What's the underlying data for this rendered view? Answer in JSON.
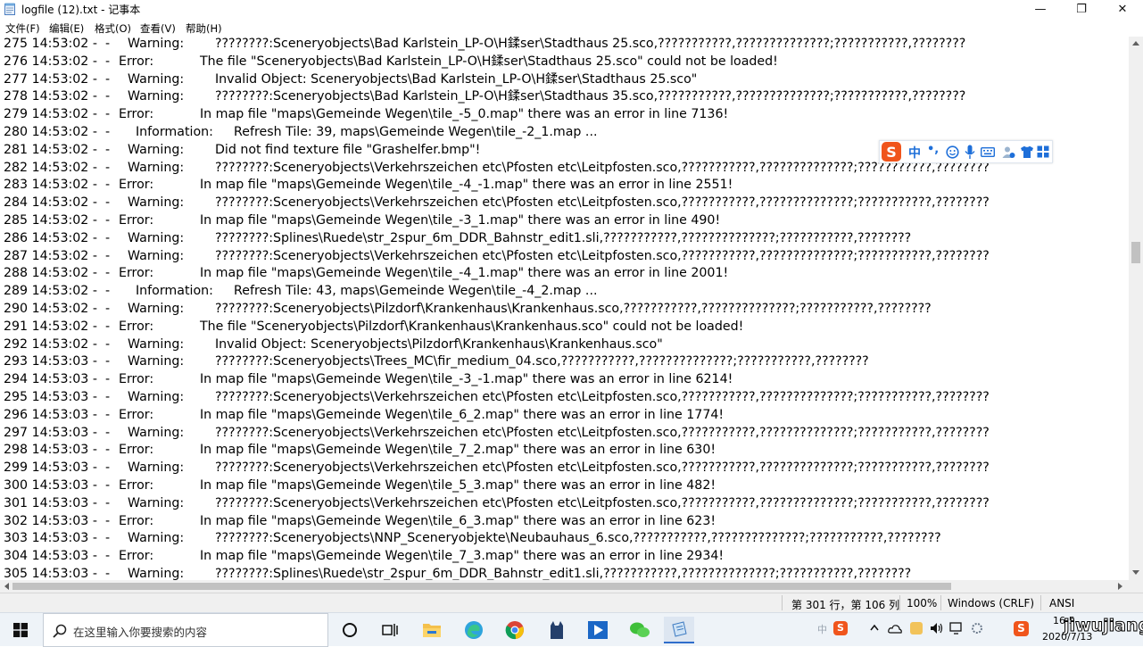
{
  "window": {
    "title": "logfile (12).txt - 记事本",
    "controls": {
      "minimize": "—",
      "maximize": "❐",
      "close": "✕"
    }
  },
  "menu": [
    "文件(F)",
    "编辑(E)",
    "格式(O)",
    "查看(V)",
    "帮助(H)"
  ],
  "log_lines": [
    {
      "prefix": "275 14:53:02 -  -",
      "level": "Warning:",
      "msg": "????????:Sceneryobjects\\Bad Karlstein_LP-O\\H鍒ser\\Stadthaus 25.sco,???????????,??????????????;???????????,????????"
    },
    {
      "prefix": "276 14:53:02 -  -",
      "level": "Error:",
      "msg": "The file \"Sceneryobjects\\Bad Karlstein_LP-O\\H鍒ser\\Stadthaus 25.sco\" could not be loaded!"
    },
    {
      "prefix": "277 14:53:02 -  -",
      "level": "Warning:",
      "msg": "Invalid Object: Sceneryobjects\\Bad Karlstein_LP-O\\H鍒ser\\Stadthaus 25.sco\""
    },
    {
      "prefix": "278 14:53:02 -  -",
      "level": "Warning:",
      "msg": "????????:Sceneryobjects\\Bad Karlstein_LP-O\\H鍒ser\\Stadthaus 35.sco,???????????,??????????????;???????????,????????"
    },
    {
      "prefix": "279 14:53:02 -  -",
      "level": "Error:",
      "msg": "In map file \"maps\\Gemeinde Wegen\\tile_-5_0.map\" there was an error in line 7136!"
    },
    {
      "prefix": "280 14:53:02 -  -",
      "level": "Information:",
      "msg": "Refresh Tile: 39, maps\\Gemeinde Wegen\\tile_-2_1.map ..."
    },
    {
      "prefix": "281 14:53:02 -  -",
      "level": "Warning:",
      "msg": "Did not find texture file \"Grashelfer.bmp\"!"
    },
    {
      "prefix": "282 14:53:02 -  -",
      "level": "Warning:",
      "msg": "????????:Sceneryobjects\\Verkehrszeichen etc\\Pfosten etc\\Leitpfosten.sco,???????????,??????????????;???????????,????????"
    },
    {
      "prefix": "283 14:53:02 -  -",
      "level": "Error:",
      "msg": "In map file \"maps\\Gemeinde Wegen\\tile_-4_-1.map\" there was an error in line 2551!"
    },
    {
      "prefix": "284 14:53:02 -  -",
      "level": "Warning:",
      "msg": "????????:Sceneryobjects\\Verkehrszeichen etc\\Pfosten etc\\Leitpfosten.sco,???????????,??????????????;???????????,????????"
    },
    {
      "prefix": "285 14:53:02 -  -",
      "level": "Error:",
      "msg": "In map file \"maps\\Gemeinde Wegen\\tile_-3_1.map\" there was an error in line 490!"
    },
    {
      "prefix": "286 14:53:02 -  -",
      "level": "Warning:",
      "msg": "????????:Splines\\Ruede\\str_2spur_6m_DDR_Bahnstr_edit1.sli,???????????,??????????????;???????????,????????"
    },
    {
      "prefix": "287 14:53:02 -  -",
      "level": "Warning:",
      "msg": "????????:Sceneryobjects\\Verkehrszeichen etc\\Pfosten etc\\Leitpfosten.sco,???????????,??????????????;???????????,????????"
    },
    {
      "prefix": "288 14:53:02 -  -",
      "level": "Error:",
      "msg": "In map file \"maps\\Gemeinde Wegen\\tile_-4_1.map\" there was an error in line 2001!"
    },
    {
      "prefix": "289 14:53:02 -  -",
      "level": "Information:",
      "msg": "Refresh Tile: 43, maps\\Gemeinde Wegen\\tile_-4_2.map ..."
    },
    {
      "prefix": "290 14:53:02 -  -",
      "level": "Warning:",
      "msg": "????????:Sceneryobjects\\Pilzdorf\\Krankenhaus\\Krankenhaus.sco,???????????,??????????????;???????????,????????"
    },
    {
      "prefix": "291 14:53:02 -  -",
      "level": "Error:",
      "msg": "The file \"Sceneryobjects\\Pilzdorf\\Krankenhaus\\Krankenhaus.sco\" could not be loaded!"
    },
    {
      "prefix": "292 14:53:02 -  -",
      "level": "Warning:",
      "msg": "Invalid Object: Sceneryobjects\\Pilzdorf\\Krankenhaus\\Krankenhaus.sco\""
    },
    {
      "prefix": "293 14:53:03 -  -",
      "level": "Warning:",
      "msg": "????????:Sceneryobjects\\Trees_MC\\fir_medium_04.sco,???????????,??????????????;???????????,????????"
    },
    {
      "prefix": "294 14:53:03 -  -",
      "level": "Error:",
      "msg": "In map file \"maps\\Gemeinde Wegen\\tile_-3_-1.map\" there was an error in line 6214!"
    },
    {
      "prefix": "295 14:53:03 -  -",
      "level": "Warning:",
      "msg": "????????:Sceneryobjects\\Verkehrszeichen etc\\Pfosten etc\\Leitpfosten.sco,???????????,??????????????;???????????,????????"
    },
    {
      "prefix": "296 14:53:03 -  -",
      "level": "Error:",
      "msg": "In map file \"maps\\Gemeinde Wegen\\tile_6_2.map\" there was an error in line 1774!"
    },
    {
      "prefix": "297 14:53:03 -  -",
      "level": "Warning:",
      "msg": "????????:Sceneryobjects\\Verkehrszeichen etc\\Pfosten etc\\Leitpfosten.sco,???????????,??????????????;???????????,????????"
    },
    {
      "prefix": "298 14:53:03 -  -",
      "level": "Error:",
      "msg": "In map file \"maps\\Gemeinde Wegen\\tile_7_2.map\" there was an error in line 630!"
    },
    {
      "prefix": "299 14:53:03 -  -",
      "level": "Warning:",
      "msg": "????????:Sceneryobjects\\Verkehrszeichen etc\\Pfosten etc\\Leitpfosten.sco,???????????,??????????????;???????????,????????"
    },
    {
      "prefix": "300 14:53:03 -  -",
      "level": "Error:",
      "msg": "In map file \"maps\\Gemeinde Wegen\\tile_5_3.map\" there was an error in line 482!"
    },
    {
      "prefix": "301 14:53:03 -  -",
      "level": "Warning:",
      "msg": "????????:Sceneryobjects\\Verkehrszeichen etc\\Pfosten etc\\Leitpfosten.sco,???????????,??????????????;???????????,????????"
    },
    {
      "prefix": "302 14:53:03 -  -",
      "level": "Error:",
      "msg": "In map file \"maps\\Gemeinde Wegen\\tile_6_3.map\" there was an error in line 623!"
    },
    {
      "prefix": "303 14:53:03 -  -",
      "level": "Warning:",
      "msg": "????????:Sceneryobjects\\NNP_Sceneryobjekte\\Neubauhaus_6.sco,???????????,??????????????;???????????,????????"
    },
    {
      "prefix": "304 14:53:03 -  -",
      "level": "Error:",
      "msg": "In map file \"maps\\Gemeinde Wegen\\tile_7_3.map\" there was an error in line 2934!"
    },
    {
      "prefix": "305 14:53:03 -  -",
      "level": "Warning:",
      "msg": "????????:Splines\\Ruede\\str_2spur_6m_DDR_Bahnstr_edit1.sli,???????????,??????????????;???????????,????????"
    }
  ],
  "ime_toolbar": {
    "logo": "S",
    "lang": "中",
    "punct": "•,",
    "icons": [
      "smiley-icon",
      "mic-icon",
      "keyboard-icon",
      "user-icon",
      "shirt-icon",
      "grid-icon"
    ]
  },
  "statusbar": {
    "position": "第 301 行，第 106 列",
    "zoom": "100%",
    "line_ending": "Windows (CRLF)",
    "encoding": "ANSI"
  },
  "taskbar": {
    "search_placeholder": "在这里输入你要搜索的内容",
    "tray_lang": "中",
    "clock_time": "16:5",
    "clock_date": "2020/7/13",
    "watermark": "jiwujiang"
  },
  "colors": {
    "taskbar_bg": "#eef3f8",
    "accent_blue": "#1e6fd9",
    "sogou_orange": "#f0551c"
  }
}
